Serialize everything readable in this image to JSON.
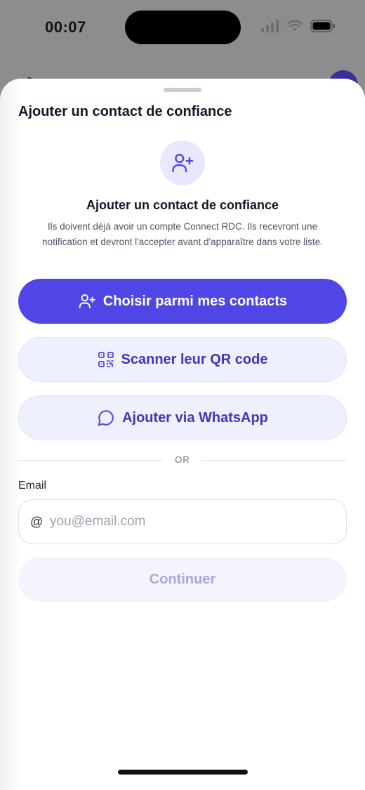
{
  "status_bar": {
    "time": "00:07"
  },
  "sheet": {
    "title": "Ajouter un contact de confiance",
    "hero_title": "Ajouter un contact de confiance",
    "hero_description": "Ils doivent déjà avoir un compte Connect RDC. Ils recevront une notification et devront l'accepter avant d'apparaître dans votre liste.",
    "hero_icon": "user-plus-icon"
  },
  "actions": {
    "choose_contacts_label": "Choisir parmi mes contacts",
    "scan_qr_label": "Scanner leur QR code",
    "whatsapp_label": "Ajouter via WhatsApp"
  },
  "divider": {
    "text": "OR"
  },
  "email": {
    "label": "Email",
    "at_symbol": "@",
    "placeholder": "you@email.com",
    "value": ""
  },
  "continue_label": "Continuer",
  "colors": {
    "primary": "#4f46e5",
    "secondary_bg": "#eef0fe",
    "secondary_text": "#3f36b8",
    "disabled_text": "#a9a6e2"
  }
}
